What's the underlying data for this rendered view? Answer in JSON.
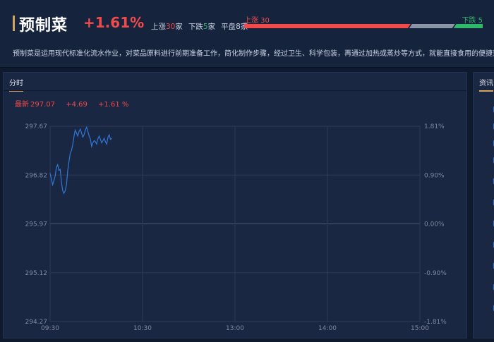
{
  "header": {
    "title": "预制菜",
    "change_pct": "+1.61%",
    "up_label": "上涨",
    "up_count": "30",
    "down_label": "下跌",
    "down_count": "5",
    "flat_label": "平盘",
    "flat_count": "8",
    "unit": "家",
    "bar_up_text": "上涨  30",
    "bar_down_text": "下跌  5",
    "description": "预制菜是运用现代标准化流水作业，对菜品原料进行前期准备工作，简化制作步骤，经过卫生、科学包装，再通过加热或蒸炒等方式，就能直接食用的便捷菜品"
  },
  "panel": {
    "tab_label": "分时",
    "latest_label": "最新",
    "latest_value": "297.07",
    "change_value": "+4.69",
    "change_pct": "+1.61 %"
  },
  "side_panel": {
    "tab_label": "资讯"
  },
  "colors": {
    "up": "#ef4b4b",
    "down": "#2fb96a",
    "flat": "#8a95a8",
    "line": "#2f78d8",
    "accent": "#d6a35a"
  },
  "breadth": {
    "up": 30,
    "down": 5,
    "flat": 8
  },
  "chart_data": {
    "type": "line",
    "x_ticks": [
      "09:30",
      "10:30",
      "13:00",
      "14:00",
      "15:00"
    ],
    "y_ticks_left": [
      "297.67",
      "296.82",
      "295.97",
      "295.12",
      "294.27"
    ],
    "y_ticks_right": [
      "1.81%",
      "0.90%",
      "0.00%",
      "-0.90%",
      "-1.81%"
    ],
    "ylim": [
      294.27,
      297.67
    ],
    "base": 295.97,
    "series": [
      {
        "values": [
          296.85,
          296.75,
          296.65,
          296.72,
          296.8,
          296.95,
          297.0,
          296.9,
          296.92,
          296.7,
          296.55,
          296.5,
          296.55,
          296.65,
          296.9,
          297.05,
          297.2,
          297.25,
          297.35,
          297.5,
          297.6,
          297.55,
          297.5,
          297.58,
          297.62,
          297.55,
          297.48,
          297.52,
          297.6,
          297.65,
          297.58,
          297.5,
          297.45,
          297.32,
          297.38,
          297.42,
          297.4,
          297.36,
          297.45,
          297.5,
          297.44,
          297.38,
          297.42,
          297.46,
          297.4,
          297.36,
          297.48,
          297.52,
          297.44,
          297.46
        ]
      }
    ]
  }
}
